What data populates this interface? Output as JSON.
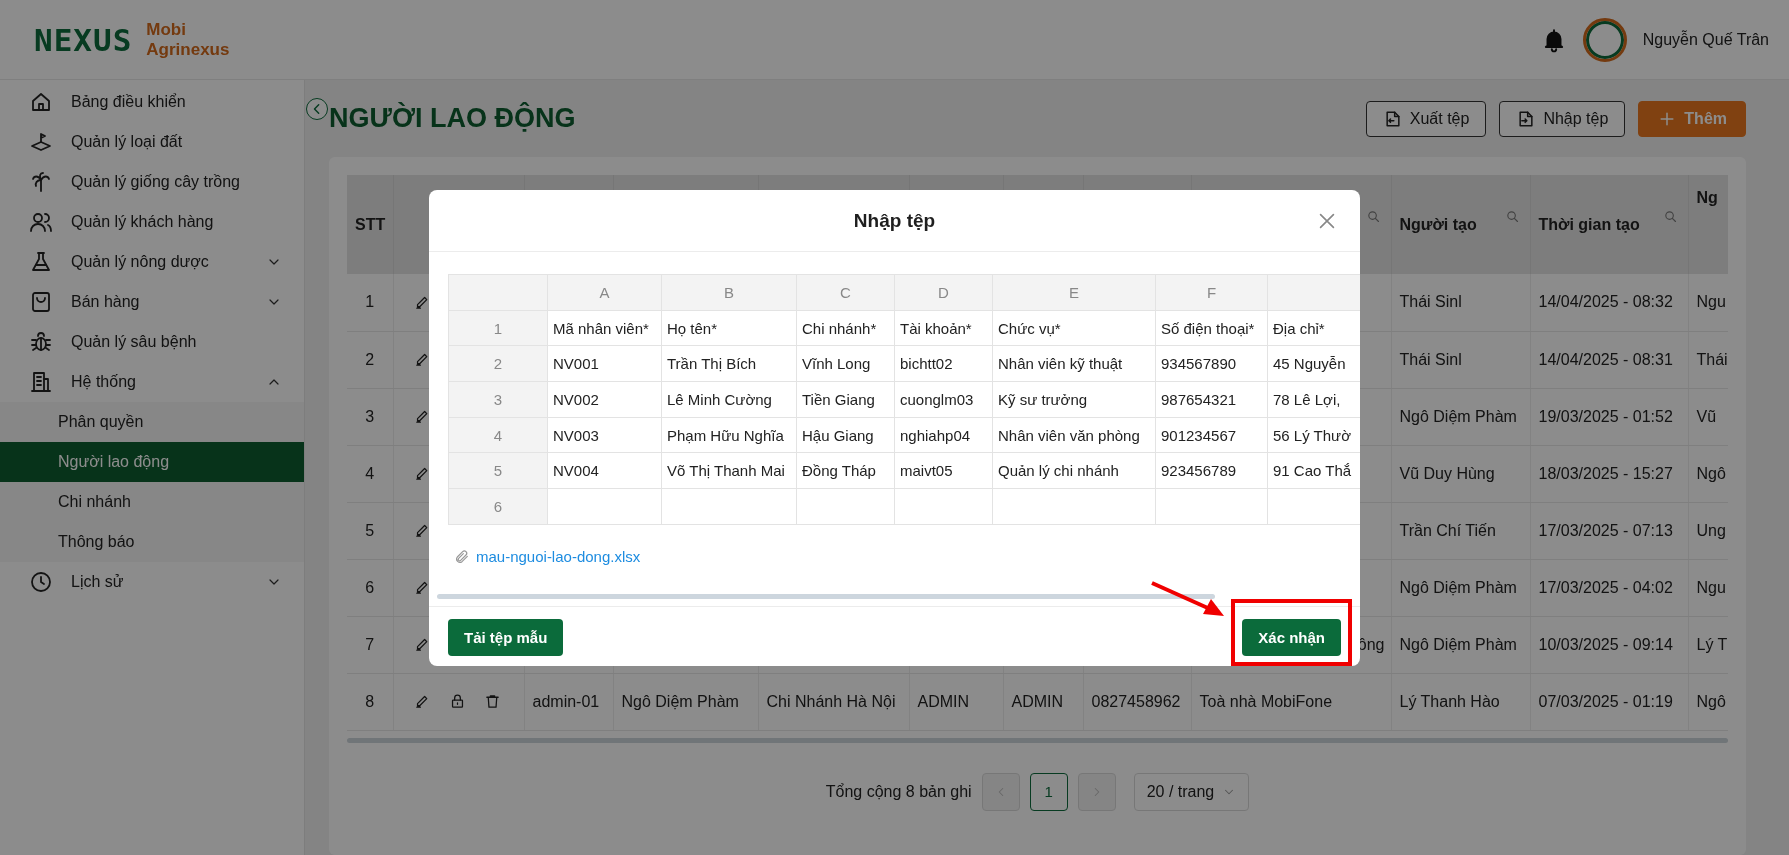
{
  "header": {
    "logo": {
      "wordmark": "NEXUS",
      "brand_line_1": "Mobi",
      "brand_line_2": "Agrinexus"
    },
    "user_name": "Nguyễn Quế Trân"
  },
  "sidebar": {
    "items": [
      {
        "label": "Bảng điều khiển",
        "kind": "link",
        "selected": false
      },
      {
        "label": "Quản lý loại đất",
        "kind": "link",
        "selected": false
      },
      {
        "label": "Quản lý giống cây trồng",
        "kind": "link",
        "selected": false
      },
      {
        "label": "Quản lý khách hàng",
        "kind": "link",
        "selected": false
      },
      {
        "label": "Quản lý nông dược",
        "kind": "group",
        "expanded": false
      },
      {
        "label": "Bán hàng",
        "kind": "group",
        "expanded": false
      },
      {
        "label": "Quản lý sâu bệnh",
        "kind": "link",
        "selected": false
      },
      {
        "label": "Hệ thống",
        "kind": "group",
        "expanded": true,
        "children": [
          {
            "label": "Phân quyền",
            "selected": false
          },
          {
            "label": "Người lao động",
            "selected": true
          },
          {
            "label": "Chi nhánh",
            "selected": false
          },
          {
            "label": "Thông báo",
            "selected": false
          }
        ]
      },
      {
        "label": "Lịch sử",
        "kind": "group",
        "expanded": false
      }
    ]
  },
  "page": {
    "title": "NGƯỜI LAO ĐỘNG",
    "actions": [
      {
        "label": "Xuất tệp",
        "kind": "export"
      },
      {
        "label": "Nhập tệp",
        "kind": "import"
      },
      {
        "label": "Thêm",
        "kind": "add"
      }
    ]
  },
  "table": {
    "header": {
      "stt": {
        "label": "STT"
      },
      "address": {
        "filter": true
      },
      "creator": {
        "label": "Người tạo",
        "filter": true
      },
      "created_at": {
        "label": "Thời gian tạo",
        "filter": true
      },
      "column_12": {
        "label": "Ng"
      }
    },
    "rows": [
      {
        "stt": "1",
        "creator": "Thái Sinl",
        "created_at": "14/04/2025 - 08:32",
        "column_12": "Ngu"
      },
      {
        "stt": "2",
        "creator": "Thái Sinl",
        "created_at": "14/04/2025 - 08:31",
        "column_12": "Thái"
      },
      {
        "stt": "3",
        "creator": "Ngô Diệm Phàm",
        "created_at": "19/03/2025 - 01:52",
        "column_12": "Vũ"
      },
      {
        "stt": "4",
        "creator": "Vũ Duy Hùng",
        "created_at": "18/03/2025 - 15:27",
        "column_12": "Ngô"
      },
      {
        "stt": "5",
        "creator": "Trần Chí Tiến",
        "created_at": "17/03/2025 - 07:13",
        "column_12": "Ung"
      },
      {
        "stt": "6",
        "creator": "Ngô Diệm Phàm",
        "created_at": "17/03/2025 - 04:02",
        "column_12": "Ngu"
      },
      {
        "stt": "7",
        "address_tail": "ông",
        "creator": "Ngô Diệm Phàm",
        "created_at": "10/03/2025 - 09:14",
        "column_12": "Lý T"
      },
      {
        "stt": "8",
        "code": "admin-01",
        "name": "Ngô Diệm Phàm",
        "branch": "Chi Nhánh Hà Nội",
        "account": "ADMIN",
        "role": "ADMIN",
        "phone": "0827458962",
        "address": "Toà nhà MobiFone",
        "creator": "Lý Thanh Hào",
        "created_at": "07/03/2025 - 01:19",
        "column_12": "Ngô"
      }
    ]
  },
  "pagination": {
    "total": "Tổng cộng 8 bản ghi",
    "prev": {
      "disabled": true
    },
    "pages": [
      {
        "label": "1",
        "selected": true
      }
    ],
    "next": {
      "disabled": true
    },
    "page_size": "20 / trang"
  },
  "import_dialog": {
    "title": "Nhập tệp",
    "sheet": {
      "column_letters": [
        "A",
        "B",
        "C",
        "D",
        "E",
        "F"
      ],
      "row_numbers": [
        "1",
        "2",
        "3",
        "4",
        "5",
        "6"
      ],
      "rows": [
        [
          "Mã nhân viên*",
          "Họ tên*",
          "Chi nhánh*",
          "Tài khoản*",
          "Chức vụ*",
          "Số điện thoại*",
          "Địa chỉ*"
        ],
        [
          "NV001",
          "Trần Thị Bích",
          "Vĩnh Long",
          "bichtt02",
          "Nhân viên kỹ thuật",
          "934567890",
          "45 Nguyễn"
        ],
        [
          "NV002",
          "Lê Minh Cường",
          "Tiền Giang",
          "cuonglm03",
          "Kỹ sư trưởng",
          "987654321",
          "78 Lê Lợi,"
        ],
        [
          "NV003",
          "Phạm Hữu Nghĩa",
          "Hậu Giang",
          "nghiahp04",
          "Nhân viên văn phòng",
          "901234567",
          "56 Lý Thườ"
        ],
        [
          "NV004",
          "Võ Thị Thanh Mai",
          "Đồng Tháp",
          "maivt05",
          "Quản lý chi nhánh",
          "923456789",
          "91 Cao Thắ"
        ]
      ]
    },
    "file_name": "mau-nguoi-lao-dong.xlsx",
    "template_button": "Tải tệp mẫu",
    "confirm_button": "Xác nhận"
  }
}
